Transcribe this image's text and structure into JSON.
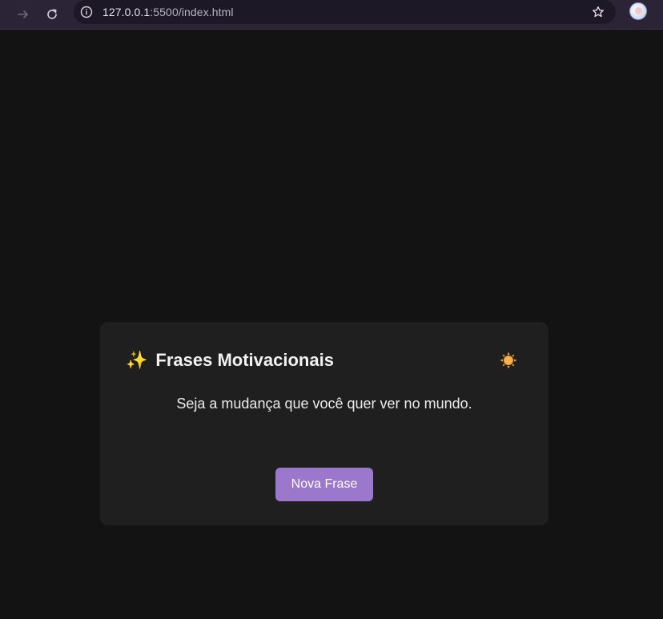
{
  "browser": {
    "url_host": "127.0.0.1",
    "url_path": ":5500/index.html",
    "icons": {
      "forward": "arrow-right-icon",
      "reload": "reload-icon",
      "info": "info-icon",
      "bookmark": "star-icon",
      "profile": "avatar"
    }
  },
  "app": {
    "title_icon": "✨",
    "title": "Frases Motivacionais",
    "theme_toggle_icon": "sun-icon",
    "quote": "Seja a mudança que você quer ver no mundo.",
    "button_label": "Nova Frase"
  },
  "colors": {
    "page_background": "#131313",
    "card_background": "#1f1f1f",
    "button_accent": "#9b78cc",
    "browser_chrome": "#2b2436",
    "sun": "#f2a03a"
  }
}
